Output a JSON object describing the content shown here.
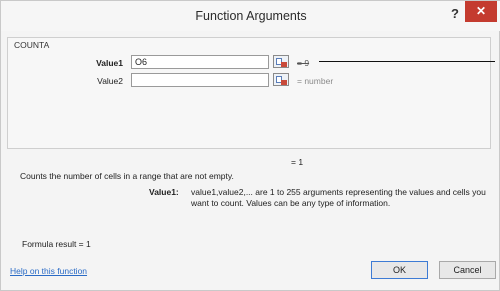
{
  "window": {
    "title": "Function Arguments",
    "help_label": "?",
    "close_label": "✕"
  },
  "function": {
    "name": "COUNTA",
    "args": [
      {
        "label": "Value1",
        "value": "O6",
        "result": "= 9"
      },
      {
        "label": "Value2",
        "value": "",
        "result": "= number"
      }
    ],
    "formula_value": "= 1",
    "description": "Counts the number of cells in a range that are not empty.",
    "arg_desc_label": "Value1:",
    "arg_desc": "value1,value2,... are 1 to 255 arguments representing the values and cells you want to count. Values can be any type of information."
  },
  "footer": {
    "formula_result": "Formula result =   1",
    "help_link": "Help on this function",
    "ok_label": "OK",
    "cancel_label": "Cancel"
  },
  "icons": {
    "ref_button": "range-selector-icon"
  }
}
